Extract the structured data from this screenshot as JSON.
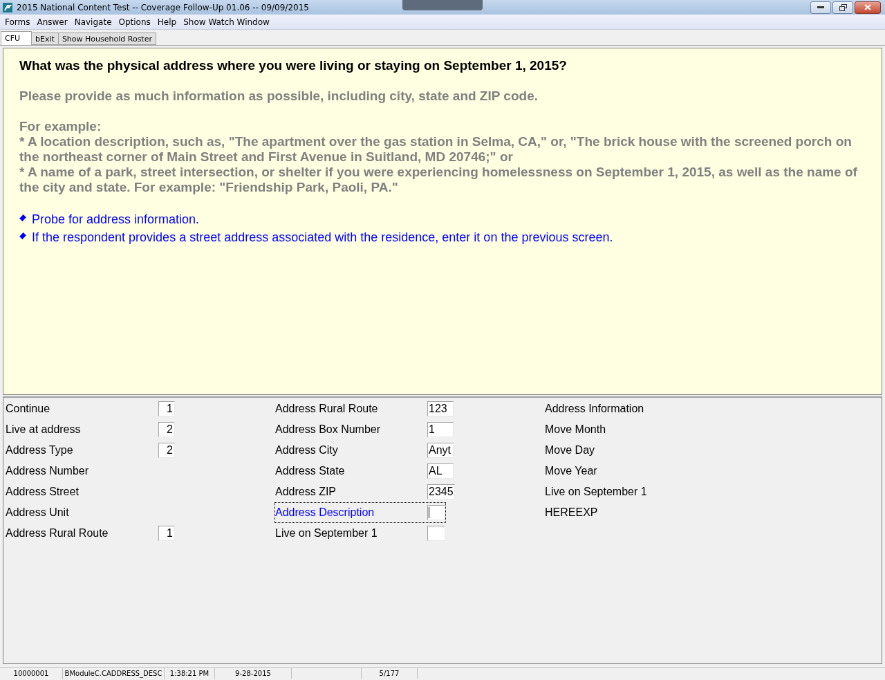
{
  "window": {
    "title": "2015 National Content Test -- Coverage Follow-Up 01.06 -- 09/09/2015"
  },
  "menu": [
    "Forms",
    "Answer",
    "Navigate",
    "Options",
    "Help",
    "Show Watch Window"
  ],
  "tabs": [
    {
      "label": "CFU",
      "selected": true
    },
    {
      "label": "bExit",
      "selected": false
    },
    {
      "label": "Show Household Roster",
      "selected": false
    }
  ],
  "question": {
    "text": "What was the physical address where you were living or staying on September 1, 2015?",
    "help": "Please provide as much information as possible, including city, state and ZIP code.",
    "example_heading": "For example:",
    "examples": [
      "* A location description, such as, \"The apartment over the gas station in Selma, CA,\" or, \"The brick house with the screened porch on the northeast corner of Main Street and First Avenue in Suitland, MD 20746;\" or",
      "* A name of a park, street intersection, or shelter if you were experiencing homelessness on September 1, 2015, as well as the name of the city and state. For example: \"Friendship Park, Paoli, PA.\""
    ],
    "instructions": [
      "Probe for address information.",
      "If the respondent provides a street address associated with the residence, enter it on the previous screen."
    ]
  },
  "field_columns": [
    [
      {
        "label": "Continue",
        "kind": "box",
        "value": "1",
        "selected": false
      },
      {
        "label": "Live at address",
        "kind": "box",
        "value": "2",
        "selected": false
      },
      {
        "label": "Address Type",
        "kind": "box",
        "value": "2",
        "selected": false
      },
      {
        "label": "Address Number",
        "kind": "plain",
        "selected": false
      },
      {
        "label": "Address Street",
        "kind": "plain",
        "selected": false
      },
      {
        "label": "Address Unit",
        "kind": "plain",
        "selected": false
      },
      {
        "label": "Address Rural Route",
        "kind": "box",
        "value": "1",
        "selected": false
      }
    ],
    [
      {
        "label": "Address Rural Route",
        "kind": "box",
        "value": "123",
        "selected": false
      },
      {
        "label": "Address Box Number",
        "kind": "box",
        "value": "1",
        "selected": false
      },
      {
        "label": "Address City",
        "kind": "box",
        "value": "Anyt",
        "selected": false
      },
      {
        "label": "Address State",
        "kind": "box",
        "value": "AL",
        "selected": false
      },
      {
        "label": "Address ZIP",
        "kind": "box",
        "value": "2345",
        "selected": false
      },
      {
        "label": "Address Description",
        "kind": "box",
        "selected": true
      },
      {
        "label": "Live on September 1",
        "kind": "box",
        "selected": false
      }
    ],
    [
      {
        "label": "Address Information",
        "kind": "plain",
        "selected": false
      },
      {
        "label": "Move Month",
        "kind": "plain",
        "selected": false
      },
      {
        "label": "Move Day",
        "kind": "plain",
        "selected": false
      },
      {
        "label": "Move Year",
        "kind": "plain",
        "selected": false
      },
      {
        "label": "Live on September 1",
        "kind": "plain",
        "selected": false
      },
      {
        "label": "HEREEXP",
        "kind": "plain",
        "selected": false
      }
    ]
  ],
  "status_bar": [
    "10000001",
    "BModuleC.CADDRESS_DESC",
    "1:38:21 PM",
    "9-28-2015",
    "5/177"
  ]
}
